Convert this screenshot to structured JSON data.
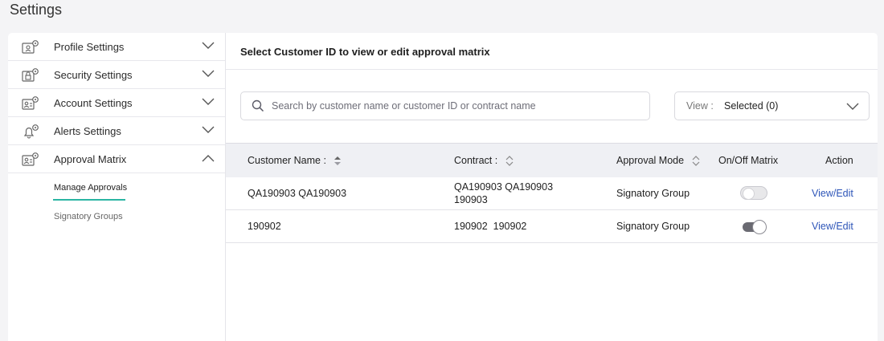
{
  "page": {
    "title": "Settings"
  },
  "sidebar": {
    "items": [
      {
        "label": "Profile Settings",
        "icon": "profile-settings-icon",
        "expanded": false
      },
      {
        "label": "Security Settings",
        "icon": "security-settings-icon",
        "expanded": false
      },
      {
        "label": "Account Settings",
        "icon": "account-settings-icon",
        "expanded": false
      },
      {
        "label": "Alerts Settings",
        "icon": "bell-settings-icon",
        "expanded": false
      },
      {
        "label": "Approval Matrix",
        "icon": "approval-matrix-icon",
        "expanded": true
      }
    ],
    "submenu": [
      {
        "label": "Manage Approvals",
        "active": true
      },
      {
        "label": "Signatory Groups",
        "active": false
      }
    ]
  },
  "main": {
    "header": "Select Customer ID to view or edit approval matrix",
    "search": {
      "placeholder": "Search by customer name or customer ID or contract name",
      "value": ""
    },
    "view": {
      "label": "View :",
      "value": "Selected (0)"
    },
    "table": {
      "columns": [
        "Customer Name :",
        "Contract :",
        "Approval Mode",
        "On/Off Matrix",
        "Action"
      ],
      "rows": [
        {
          "customer_name": "QA190903 QA190903",
          "contract_line1": "QA190903 QA190903",
          "contract_line2": "190903",
          "approval_mode": "Signatory Group",
          "matrix_on": false,
          "action": "View/Edit"
        },
        {
          "customer_name": "190902",
          "contract_line1": "190902  190902",
          "contract_line2": "",
          "approval_mode": "Signatory Group",
          "matrix_on": true,
          "action": "View/Edit"
        }
      ]
    }
  },
  "colors": {
    "accent": "#2bb5a3",
    "link": "#2d55b8",
    "header_bg": "#eff0f4",
    "page_bg": "#f4f4f6"
  }
}
